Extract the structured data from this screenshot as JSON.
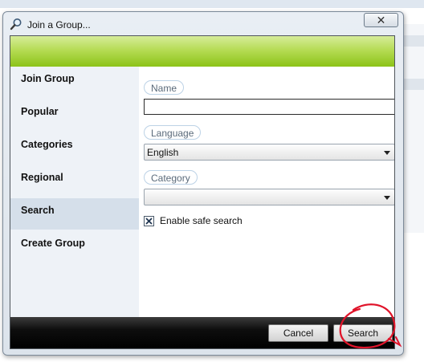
{
  "dialog": {
    "title": "Join a Group...",
    "close_symbol": "✕"
  },
  "sidebar": {
    "items": [
      {
        "label": "Join Group"
      },
      {
        "label": "Popular"
      },
      {
        "label": "Categories"
      },
      {
        "label": "Regional"
      },
      {
        "label": "Search",
        "selected": true
      },
      {
        "label": "Create Group"
      }
    ]
  },
  "form": {
    "name_label": "Name",
    "name_value": "",
    "language_label": "Language",
    "language_value": "English",
    "category_label": "Category",
    "category_value": "",
    "safe_search_label": "Enable safe search",
    "safe_search_checked": true
  },
  "footer": {
    "cancel_label": "Cancel",
    "search_label": "Search"
  },
  "colors": {
    "accent_green": "#8cc318",
    "selected_nav": "#d5dfea",
    "annotation_red": "#e0142a"
  },
  "icons": {
    "title": "magnifier-icon",
    "checkbox": "checkmark-x-icon",
    "select": "chevron-down-icon"
  }
}
